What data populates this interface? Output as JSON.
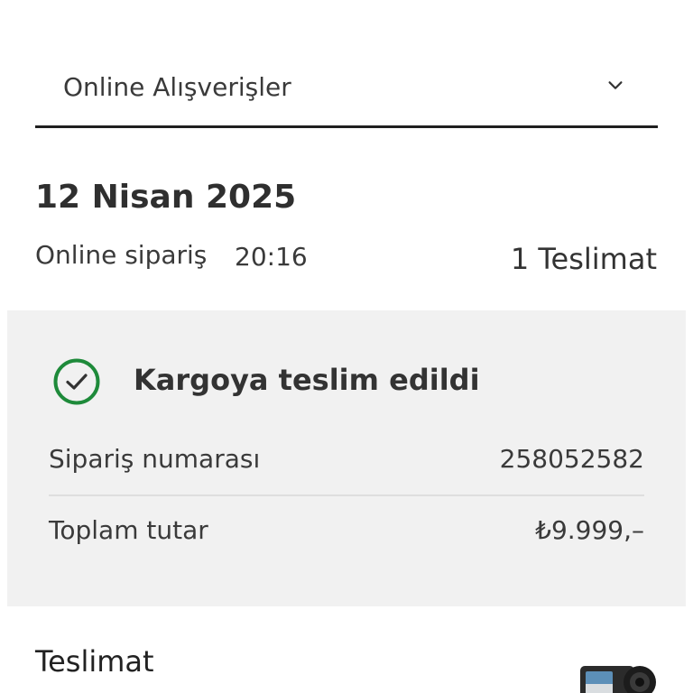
{
  "filter": {
    "selected": "Online Alışverişler",
    "icon": "chevron-down-icon"
  },
  "order": {
    "date": "12 Nisan 2025",
    "type": "Online sipariş",
    "time": "20:16",
    "delivery_count": "1 Teslimat"
  },
  "card": {
    "status_icon": "check-circle-icon",
    "status_color": "#1e8a3a",
    "status": "Kargoya teslim edildi",
    "rows": [
      {
        "label": "Sipariş numarası",
        "value": "258052582"
      },
      {
        "label": "Toplam tutar",
        "value": "₺9.999,–"
      }
    ]
  },
  "delivery": {
    "heading": "Teslimat",
    "product_image": "action-camera-image"
  }
}
